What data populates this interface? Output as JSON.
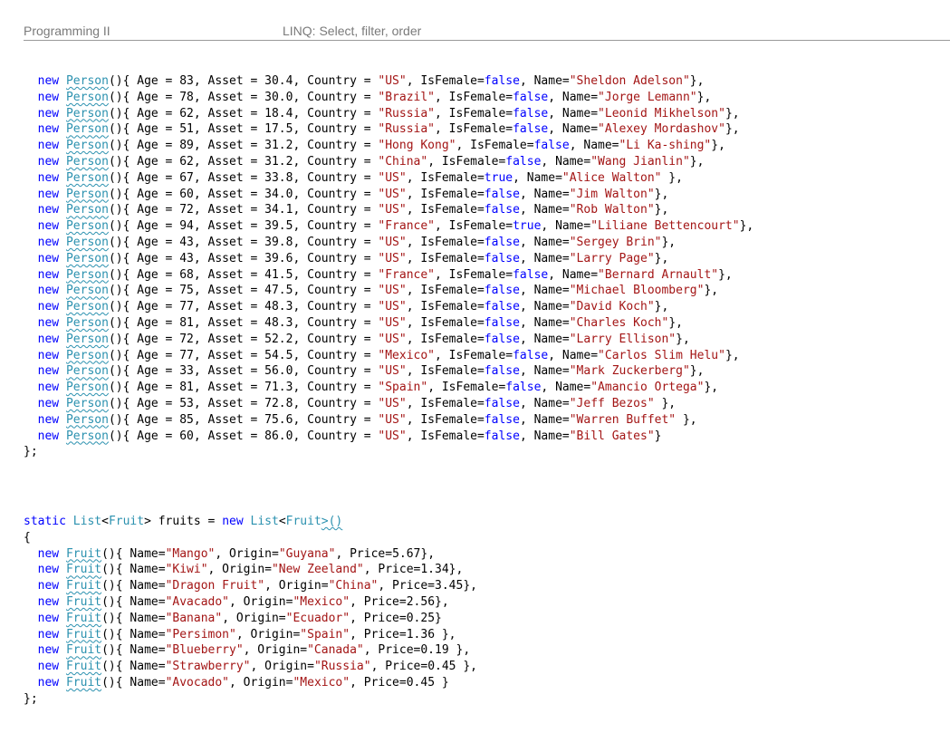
{
  "header": {
    "course": "Programming II",
    "topic": "LINQ: Select, filter, order"
  },
  "keywords": {
    "new": "new",
    "static": "static",
    "true": "true",
    "false": "false"
  },
  "types": {
    "person": "Person",
    "fruit": "Fruit",
    "list": "List"
  },
  "persons": [
    {
      "age": "83",
      "asset": "30.4",
      "country": "\"US\"",
      "isFemale": "false",
      "name": "\"Sheldon Adelson\"",
      "tail": "},"
    },
    {
      "age": "78",
      "asset": "30.0",
      "country": "\"Brazil\"",
      "isFemale": "false",
      "name": "\"Jorge Lemann\"",
      "tail": "},"
    },
    {
      "age": "62",
      "asset": "18.4",
      "country": "\"Russia\"",
      "isFemale": "false",
      "name": "\"Leonid Mikhelson\"",
      "tail": "},"
    },
    {
      "age": "51",
      "asset": "17.5",
      "country": "\"Russia\"",
      "isFemale": "false",
      "name": "\"Alexey Mordashov\"",
      "tail": "},"
    },
    {
      "age": "89",
      "asset": "31.2",
      "country": "\"Hong Kong\"",
      "isFemale": "false",
      "name": "\"Li Ka-shing\"",
      "tail": "},"
    },
    {
      "age": "62",
      "asset": "31.2",
      "country": "\"China\"",
      "isFemale": "false",
      "name": "\"Wang Jianlin\"",
      "tail": "},"
    },
    {
      "age": "67",
      "asset": "33.8",
      "country": "\"US\"",
      "isFemale": "true",
      "name": "\"Alice Walton\"",
      "tail": " },"
    },
    {
      "age": "60",
      "asset": "34.0",
      "country": "\"US\"",
      "isFemale": "false",
      "name": "\"Jim Walton\"",
      "tail": "},"
    },
    {
      "age": "72",
      "asset": "34.1",
      "country": "\"US\"",
      "isFemale": "false",
      "name": "\"Rob Walton\"",
      "tail": "},"
    },
    {
      "age": "94",
      "asset": "39.5",
      "country": "\"France\"",
      "isFemale": "true",
      "name": "\"Liliane Bettencourt\"",
      "tail": "},"
    },
    {
      "age": "43",
      "asset": "39.8",
      "country": "\"US\"",
      "isFemale": "false",
      "name": "\"Sergey Brin\"",
      "tail": "},"
    },
    {
      "age": "43",
      "asset": "39.6",
      "country": "\"US\"",
      "isFemale": "false",
      "name": "\"Larry Page\"",
      "tail": "},"
    },
    {
      "age": "68",
      "asset": "41.5",
      "country": "\"France\"",
      "isFemale": "false",
      "name": "\"Bernard Arnault\"",
      "tail": "},"
    },
    {
      "age": "75",
      "asset": "47.5",
      "country": "\"US\"",
      "isFemale": "false",
      "name": "\"Michael Bloomberg\"",
      "tail": "},"
    },
    {
      "age": "77",
      "asset": "48.3",
      "country": "\"US\"",
      "isFemale": "false",
      "name": "\"David Koch\"",
      "tail": "},"
    },
    {
      "age": "81",
      "asset": "48.3",
      "country": "\"US\"",
      "isFemale": "false",
      "name": "\"Charles Koch\"",
      "tail": "},"
    },
    {
      "age": "72",
      "asset": "52.2",
      "country": "\"US\"",
      "isFemale": "false",
      "name": "\"Larry Ellison\"",
      "tail": "},"
    },
    {
      "age": "77",
      "asset": "54.5",
      "country": "\"Mexico\"",
      "isFemale": "false",
      "name": "\"Carlos Slim Helu\"",
      "tail": "},"
    },
    {
      "age": "33",
      "asset": "56.0",
      "country": "\"US\"",
      "isFemale": "false",
      "name": "\"Mark Zuckerberg\"",
      "tail": "},"
    },
    {
      "age": "81",
      "asset": "71.3",
      "country": "\"Spain\"",
      "isFemale": "false",
      "name": "\"Amancio Ortega\"",
      "tail": "},"
    },
    {
      "age": "53",
      "asset": "72.8",
      "country": "\"US\"",
      "isFemale": "false",
      "name": "\"Jeff Bezos\"",
      "tail": " },"
    },
    {
      "age": "85",
      "asset": "75.6",
      "country": "\"US\"",
      "isFemale": "false",
      "name": "\"Warren Buffet\"",
      "tail": " },"
    },
    {
      "age": "60",
      "asset": "86.0",
      "country": "\"US\"",
      "isFemale": "false",
      "name": "\"Bill Gates\"",
      "tail": "}"
    }
  ],
  "persons_close": "};",
  "fruits_decl": {
    "var_part": " fruits = ",
    "open_brace": "{",
    "close": "};"
  },
  "fruits": [
    {
      "name": "\"Mango\"",
      "origin": "\"Guyana\"",
      "price": "5.67",
      "tail": "},"
    },
    {
      "name": "\"Kiwi\"",
      "origin": "\"New Zeeland\"",
      "price": "1.34",
      "tail": "},"
    },
    {
      "name": "\"Dragon Fruit\"",
      "origin": "\"China\"",
      "price": "3.45",
      "tail": "},"
    },
    {
      "name": "\"Avacado\"",
      "origin": "\"Mexico\"",
      "price": "2.56",
      "tail": "},"
    },
    {
      "name": "\"Banana\"",
      "origin": "\"Ecuador\"",
      "price": "0.25",
      "tail": "}"
    },
    {
      "name": "\"Persimon\"",
      "origin": "\"Spain\"",
      "price": "1.36",
      "tail": " },"
    },
    {
      "name": "\"Blueberry\"",
      "origin": "\"Canada\"",
      "price": "0.19",
      "tail": " },"
    },
    {
      "name": "\"Strawberry\"",
      "origin": "\"Russia\"",
      "price": "0.45",
      "tail": " },"
    },
    {
      "name": "\"Avocado\"",
      "origin": "\"Mexico\"",
      "price": "0.45",
      "tail": " }"
    }
  ]
}
